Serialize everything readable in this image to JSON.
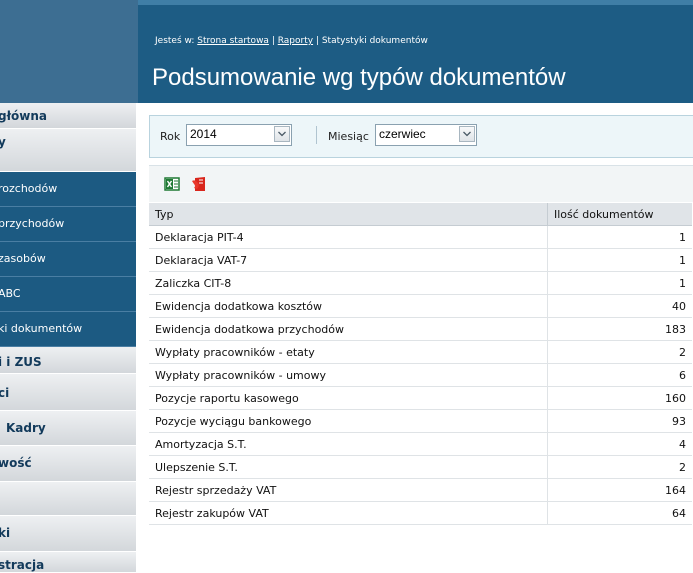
{
  "header": {
    "breadcrumb_prefix": "Jesteś w: ",
    "breadcrumb_home": "Strona startowa",
    "breadcrumb_sep1": " | ",
    "breadcrumb_reports": "Raporty",
    "breadcrumb_sep2": " | ",
    "breadcrumb_current": "Statystyki dokumentów",
    "title": "Podsumowanie wg typów dokumentów"
  },
  "sidebar": {
    "items": [
      {
        "label": "główna",
        "kind": "main"
      },
      {
        "label": "y",
        "kind": "main"
      },
      {
        "label": "rozchodów",
        "kind": "sub"
      },
      {
        "label": "przychodów",
        "kind": "sub"
      },
      {
        "label": "zasobów",
        "kind": "sub"
      },
      {
        "label": "ABC",
        "kind": "sub"
      },
      {
        "label": "ki dokumentów",
        "kind": "sub"
      },
      {
        "label": "i i ZUS",
        "kind": "main"
      },
      {
        "label": "ci",
        "kind": "main"
      },
      {
        "label": "Kadry",
        "kind": "main"
      },
      {
        "label": "wość",
        "kind": "main"
      },
      {
        "label": "",
        "kind": "main"
      },
      {
        "label": "ki",
        "kind": "main"
      },
      {
        "label": "stracja",
        "kind": "main"
      }
    ]
  },
  "filters": {
    "year_label": "Rok",
    "year_value": "2014",
    "month_label": "Miesiąc",
    "month_value": "czerwiec"
  },
  "export": {
    "excel_icon": "excel-icon",
    "pdf_icon": "pdf-icon",
    "excel_color": "#1f7a34",
    "pdf_color": "#d9261c"
  },
  "table": {
    "col_type": "Typ",
    "col_count": "Ilość dokumentów",
    "rows": [
      {
        "type": "Deklaracja PIT-4",
        "count": "1"
      },
      {
        "type": "Deklaracja VAT-7",
        "count": "1"
      },
      {
        "type": "Zaliczka CIT-8",
        "count": "1"
      },
      {
        "type": "Ewidencja dodatkowa kosztów",
        "count": "40"
      },
      {
        "type": "Ewidencja dodatkowa przychodów",
        "count": "183"
      },
      {
        "type": "Wypłaty pracowników - etaty",
        "count": "2"
      },
      {
        "type": "Wypłaty pracowników - umowy",
        "count": "6"
      },
      {
        "type": "Pozycje raportu kasowego",
        "count": "160"
      },
      {
        "type": "Pozycje wyciągu bankowego",
        "count": "93"
      },
      {
        "type": "Amortyzacja S.T.",
        "count": "4"
      },
      {
        "type": "Ulepszenie S.T.",
        "count": "2"
      },
      {
        "type": "Rejestr sprzedaży VAT",
        "count": "164"
      },
      {
        "type": "Rejestr zakupów VAT",
        "count": "64"
      }
    ]
  }
}
